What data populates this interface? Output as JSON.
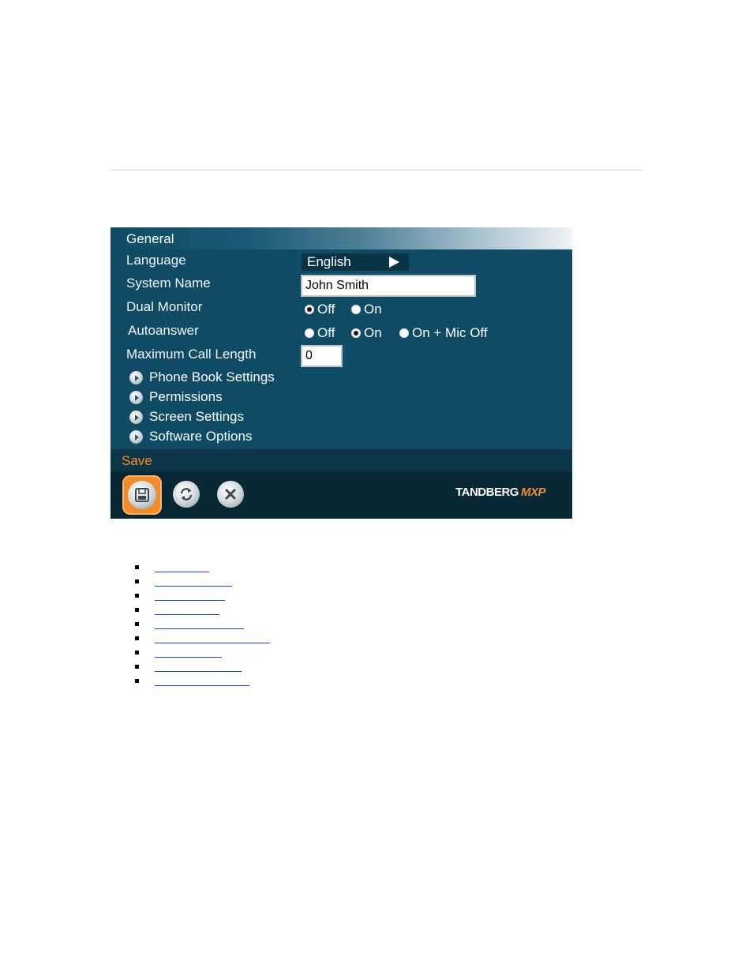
{
  "panel": {
    "title": "General",
    "fields": {
      "language": {
        "label": "Language",
        "value": "English"
      },
      "system_name": {
        "label": "System Name",
        "value": "John Smith"
      },
      "dual_monitor": {
        "label": "Dual Monitor",
        "options": [
          "Off",
          "On"
        ],
        "selected": "Off"
      },
      "autoanswer": {
        "label": "Autoanswer",
        "options": [
          "Off",
          "On",
          "On + Mic Off"
        ],
        "selected": "On"
      },
      "max_call_length": {
        "label": "Maximum Call Length",
        "value": "0"
      }
    },
    "submenus": [
      "Phone Book Settings",
      "Permissions",
      "Screen Settings",
      "Software Options"
    ],
    "save_label": "Save",
    "icons": [
      "floppy-disk-icon",
      "refresh-icon",
      "close-icon"
    ],
    "brand": {
      "name": "TANDBERG",
      "suffix": "MXP"
    },
    "colors": {
      "panel_bg": "#0f4b64",
      "accent": "#f08c2a",
      "save_text": "#ff8a1f"
    }
  },
  "link_list": {
    "count": 9
  }
}
